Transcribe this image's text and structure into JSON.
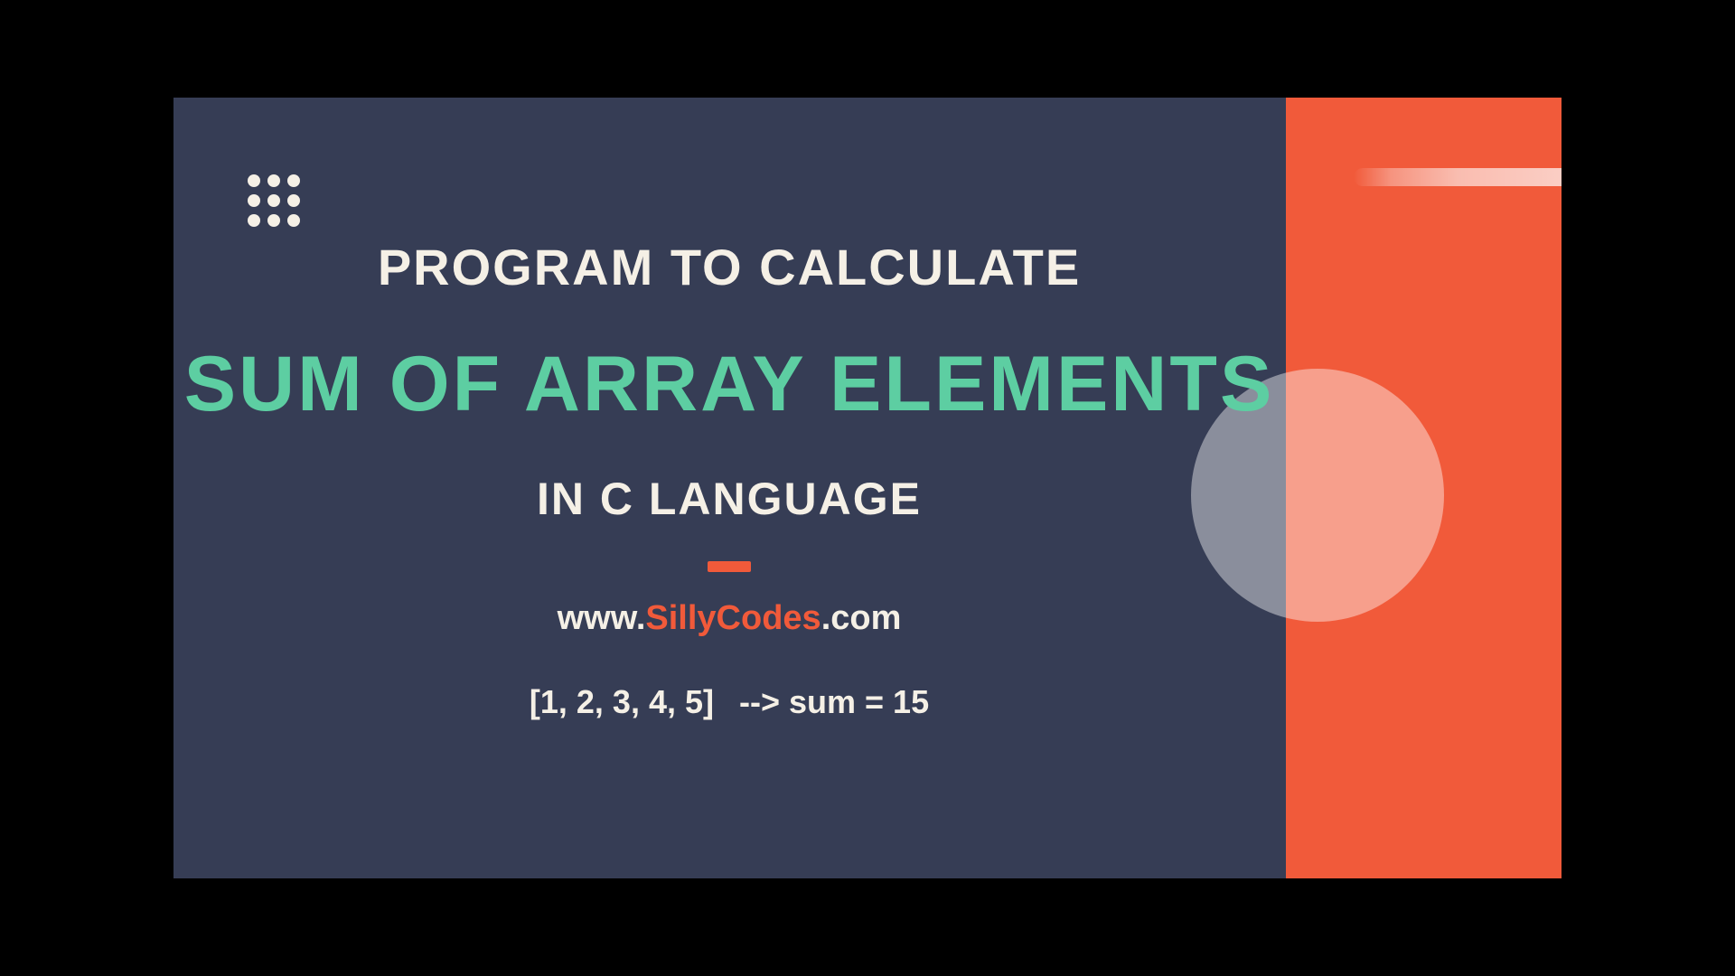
{
  "heading": {
    "line1": "Program to Calculate",
    "main": "Sum of Array Elements",
    "line2": "In C Language"
  },
  "url": {
    "prefix": "www.",
    "name": "SillyCodes",
    "suffix": ".com"
  },
  "example": {
    "array": "[1, 2, 3, 4, 5]",
    "result": "--> sum = 15"
  }
}
